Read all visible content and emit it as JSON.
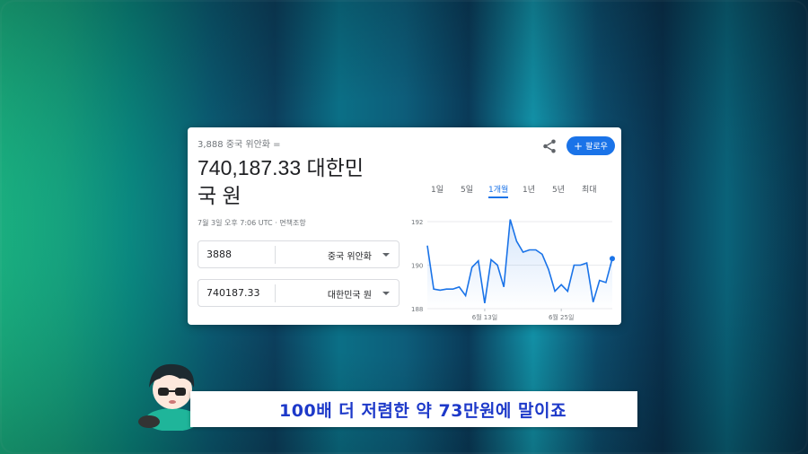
{
  "converter": {
    "subtitle": "3,888 중국 위안화 =",
    "result_line1": "740,187.33 대한민",
    "result_line2": "국 원",
    "timestamp": "7월 3일 오후 7:06 UTC · 면책조항",
    "follow_label": "팔로우",
    "from": {
      "value": "3888",
      "unit": "중국 위안화"
    },
    "to": {
      "value": "740187.33",
      "unit": "대한민국 원"
    },
    "accent_color": "#1a73e8"
  },
  "range_tabs": [
    "1일",
    "5일",
    "1개월",
    "1년",
    "5년",
    "최대"
  ],
  "active_tab": "1개월",
  "chart_data": {
    "type": "line",
    "ylim": [
      188,
      192
    ],
    "y_ticks": [
      "192",
      "190",
      "188"
    ],
    "x_tick_labels": [
      "6월 13일",
      "6월 25일"
    ],
    "series": [
      {
        "values": [
          190.9,
          188.9,
          188.85,
          188.9,
          188.9,
          189.0,
          188.6,
          189.9,
          190.2,
          188.25,
          190.25,
          190.0,
          189.0,
          192.1,
          191.1,
          190.6,
          190.7,
          190.7,
          190.5,
          189.8,
          188.8,
          189.1,
          188.8,
          190.0,
          190.0,
          190.1,
          188.3,
          189.3,
          189.2,
          190.3
        ]
      }
    ],
    "line_color": "#1a73e8",
    "grid": true
  },
  "banner": {
    "text": "100배 더 저렴한 약 73만원에 말이죠",
    "text_color": "#1d39c9"
  }
}
